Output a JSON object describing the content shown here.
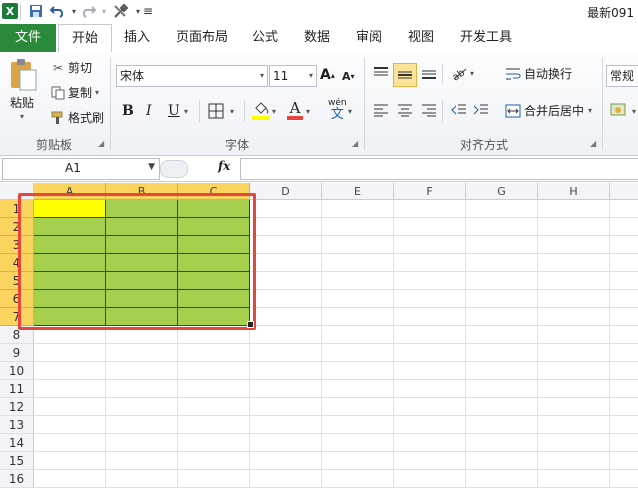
{
  "title_bar": {
    "title": "最新091"
  },
  "tabs": [
    "文件",
    "开始",
    "插入",
    "页面布局",
    "公式",
    "数据",
    "审阅",
    "视图",
    "开发工具"
  ],
  "clipboard": {
    "paste": "粘贴",
    "cut": "剪切",
    "copy": "复制",
    "format_painter": "格式刷",
    "group_label": "剪贴板"
  },
  "font": {
    "name": "宋体",
    "size": "11",
    "group_label": "字体",
    "bold": "B",
    "italic": "I",
    "underline": "U",
    "wen": "wén",
    "wen_char": "文"
  },
  "alignment": {
    "wrap_text": "自动换行",
    "merge_center": "合并后居中",
    "group_label": "对齐方式"
  },
  "number": {
    "format": "常规"
  },
  "formula_bar": {
    "name_box": "A1",
    "fx": "fx"
  },
  "grid": {
    "columns": [
      "A",
      "B",
      "C",
      "D",
      "E",
      "F",
      "G",
      "H"
    ],
    "rows": [
      "1",
      "2",
      "3",
      "4",
      "5",
      "6",
      "7",
      "8",
      "9",
      "10",
      "11",
      "12",
      "13",
      "14",
      "15",
      "16"
    ],
    "selection_range": "A1:C7",
    "fill_color": "#a5cf4c",
    "active_cell_color": "#ffff00",
    "highlight_box_color": "#e8453c"
  },
  "colors": {
    "file_tab": "#2a8a3a",
    "excel_icon": "#1d7a3a"
  }
}
